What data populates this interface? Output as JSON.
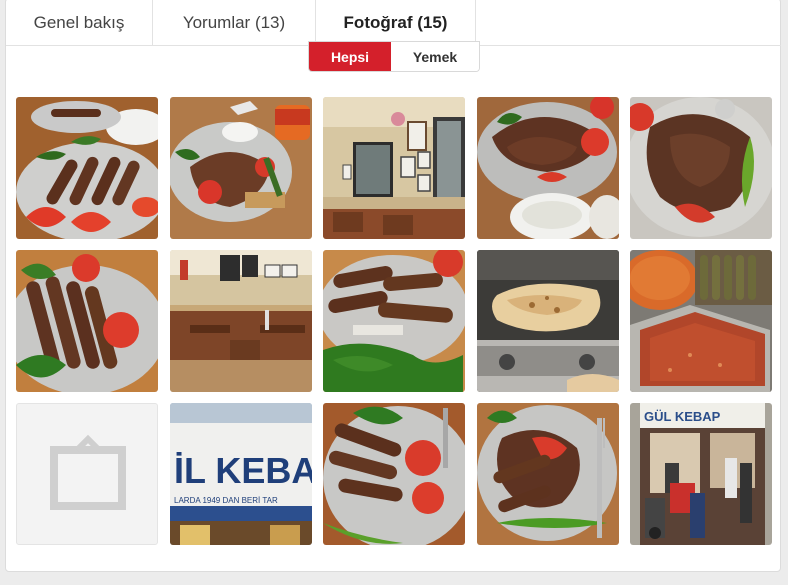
{
  "tabs": [
    {
      "label": "Genel bakış",
      "active": false
    },
    {
      "label": "Yorumlar (13)",
      "active": false
    },
    {
      "label": "Fotoğraf (15)",
      "active": true
    }
  ],
  "filter": {
    "options": [
      "Hepsi",
      "Yemek"
    ],
    "selected": "Hepsi"
  },
  "colors": {
    "accent": "#d4202b",
    "background": "#ececec",
    "panel": "#ffffff"
  },
  "photos": [
    {
      "subject": "plate-kofte-tomato"
    },
    {
      "subject": "plate-doner-yogurt"
    },
    {
      "subject": "restaurant-interior-wall"
    },
    {
      "subject": "plate-doner-closeup"
    },
    {
      "subject": "plate-doner-pepper"
    },
    {
      "subject": "plate-adana-kebab"
    },
    {
      "subject": "restaurant-interior-tables"
    },
    {
      "subject": "plate-kofte-parsley"
    },
    {
      "subject": "lavash-bread-grill"
    },
    {
      "subject": "raw-kebab-trays"
    },
    {
      "subject": "placeholder"
    },
    {
      "subject": "restaurant-sign"
    },
    {
      "subject": "plate-kofte-pepper"
    },
    {
      "subject": "plate-kebab-fork"
    },
    {
      "subject": "restaurant-storefront"
    }
  ],
  "sign": {
    "main": "İL KEBA",
    "sub": "LARDA 1949 DAN BERİ TAR",
    "storefront": "GÜL KEBAP"
  }
}
